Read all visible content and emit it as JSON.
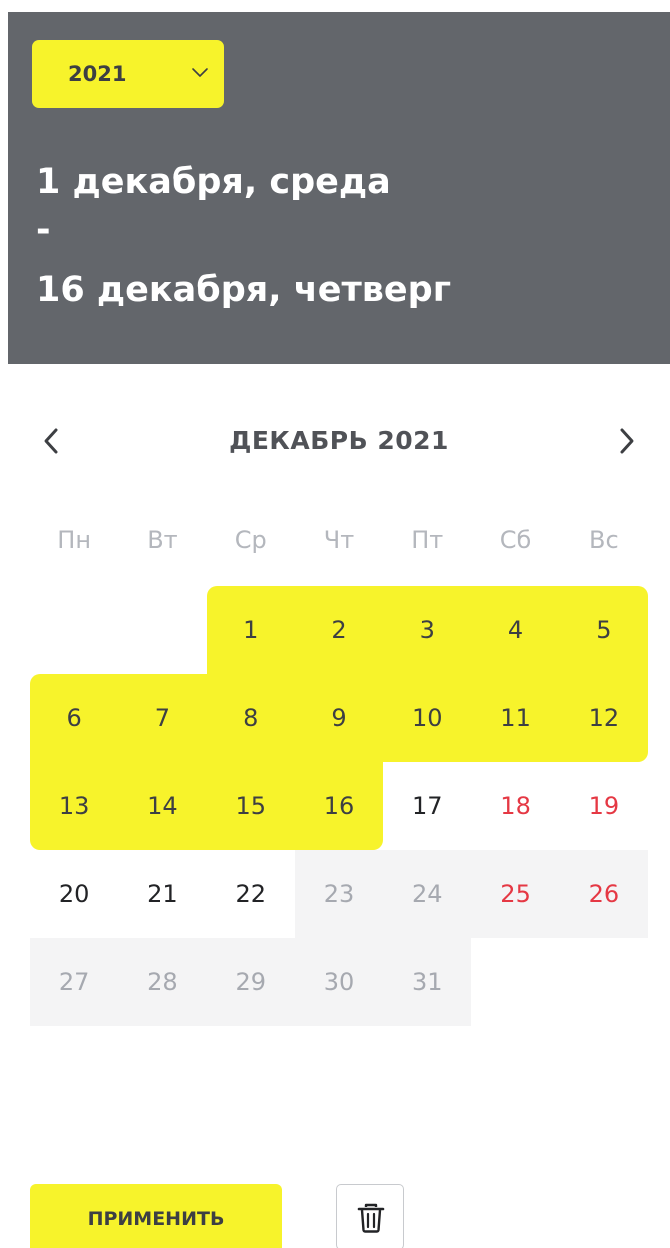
{
  "header": {
    "year_select": {
      "value": "2021",
      "icon": "chevron-down-icon"
    },
    "range_start": "1 декабря, среда",
    "range_separator": "-",
    "range_end": "16 декабря, четверг"
  },
  "calendar": {
    "month_label": "ДЕКАБРЬ 2021",
    "prev_icon": "chevron-left-icon",
    "next_icon": "chevron-right-icon",
    "weekdays": [
      "Пн",
      "Вт",
      "Ср",
      "Чт",
      "Пт",
      "Сб",
      "Вс"
    ],
    "first_weekday_index": 2,
    "days": [
      "1",
      "2",
      "3",
      "4",
      "5",
      "6",
      "7",
      "8",
      "9",
      "10",
      "11",
      "12",
      "13",
      "14",
      "15",
      "16",
      "17",
      "18",
      "19",
      "20",
      "21",
      "22",
      "23",
      "24",
      "25",
      "26",
      "27",
      "28",
      "29",
      "30",
      "31"
    ],
    "selected_range": {
      "from": 1,
      "to": 16
    },
    "disabled_from": 23
  },
  "footer": {
    "apply_label": "ПРИМЕНИТЬ",
    "delete_icon": "trash-icon"
  },
  "colors": {
    "accent_yellow": "#f7f32b",
    "header_bg": "#63666b",
    "weekend_red": "#e53844",
    "disabled_bg": "#f4f4f5",
    "disabled_text": "#a6a9b0"
  }
}
